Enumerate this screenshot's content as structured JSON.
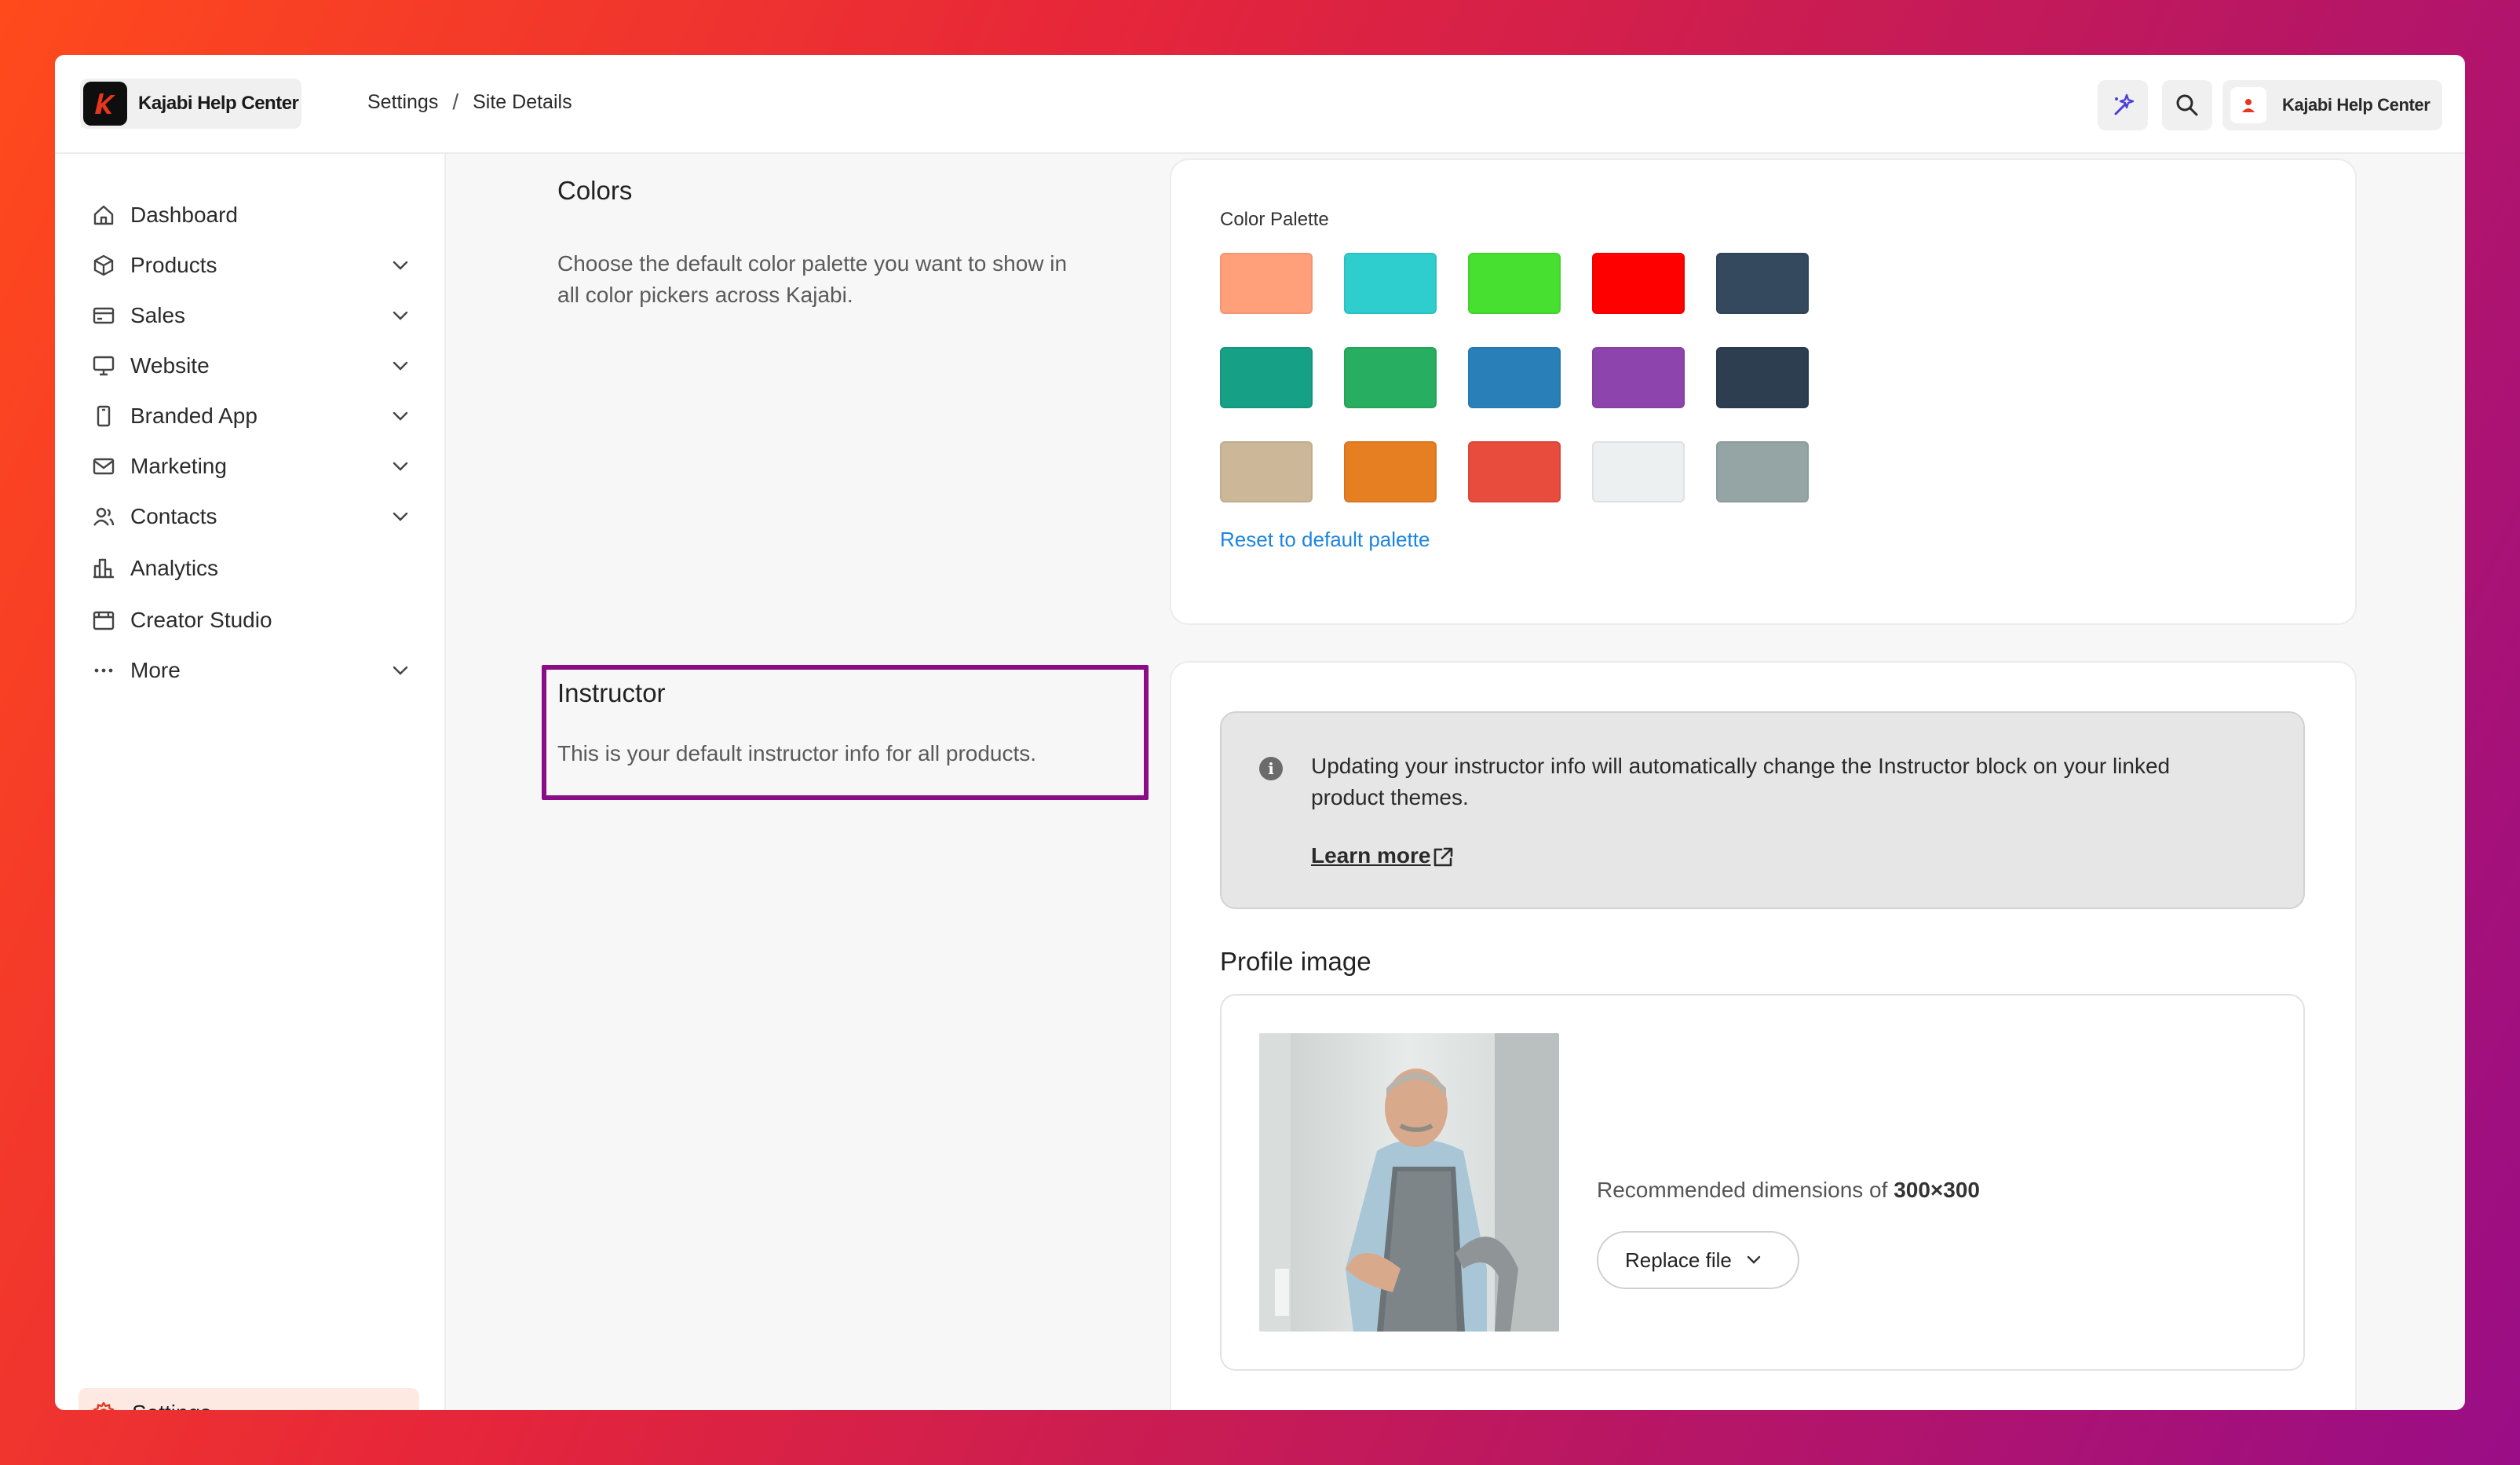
{
  "app": {
    "brand_name": "Kajabi Help Center",
    "account_name": "Kajabi Help Center"
  },
  "breadcrumb": {
    "items": [
      "Settings",
      "Site Details"
    ],
    "separator": "/"
  },
  "sidebar": {
    "items": [
      {
        "label": "Dashboard",
        "icon": "home-icon",
        "expandable": false
      },
      {
        "label": "Products",
        "icon": "box-icon",
        "expandable": true
      },
      {
        "label": "Sales",
        "icon": "credit-card-icon",
        "expandable": true
      },
      {
        "label": "Website",
        "icon": "monitor-icon",
        "expandable": true
      },
      {
        "label": "Branded App",
        "icon": "phone-icon",
        "expandable": true
      },
      {
        "label": "Marketing",
        "icon": "mail-icon",
        "expandable": true
      },
      {
        "label": "Contacts",
        "icon": "contacts-icon",
        "expandable": true
      },
      {
        "label": "Analytics",
        "icon": "bar-chart-icon",
        "expandable": false
      },
      {
        "label": "Creator Studio",
        "icon": "calendar-icon",
        "expandable": false
      },
      {
        "label": "More",
        "icon": "more-dots-icon",
        "expandable": true
      }
    ],
    "settings": {
      "label": "Settings",
      "icon": "gear-icon",
      "active": true
    }
  },
  "colors_section": {
    "title": "Colors",
    "description_line1": "Choose the default color palette you want to show in",
    "description_line2": "all color pickers across Kajabi.",
    "palette_label": "Color Palette",
    "swatches": [
      [
        "#FFA07A",
        "#2ECECE",
        "#48E030",
        "#FF0000",
        "#34495E"
      ],
      [
        "#16A085",
        "#27AE60",
        "#2980B9",
        "#8E44AD",
        "#2C3E50"
      ],
      [
        "#CCB899",
        "#E67E22",
        "#E74C3C",
        "#ECF0F1",
        "#95A5A6"
      ]
    ],
    "reset_label": "Reset to default palette"
  },
  "instructor_section": {
    "title": "Instructor",
    "description": "This is your default instructor info for all products.",
    "notice_line1": "Updating your instructor info will automatically change the Instructor block on your linked",
    "notice_line2": "product themes.",
    "notice_link": "Learn more",
    "profile_title": "Profile image",
    "recommended_prefix": "Recommended dimensions of ",
    "recommended_value": "300×300",
    "replace_label": "Replace file"
  },
  "colors": {
    "accent_link": "#1d84e0",
    "settings_active_bg": "#fde8e2",
    "highlight_border": "#8a0d85",
    "brand_red": "#e8351e"
  }
}
